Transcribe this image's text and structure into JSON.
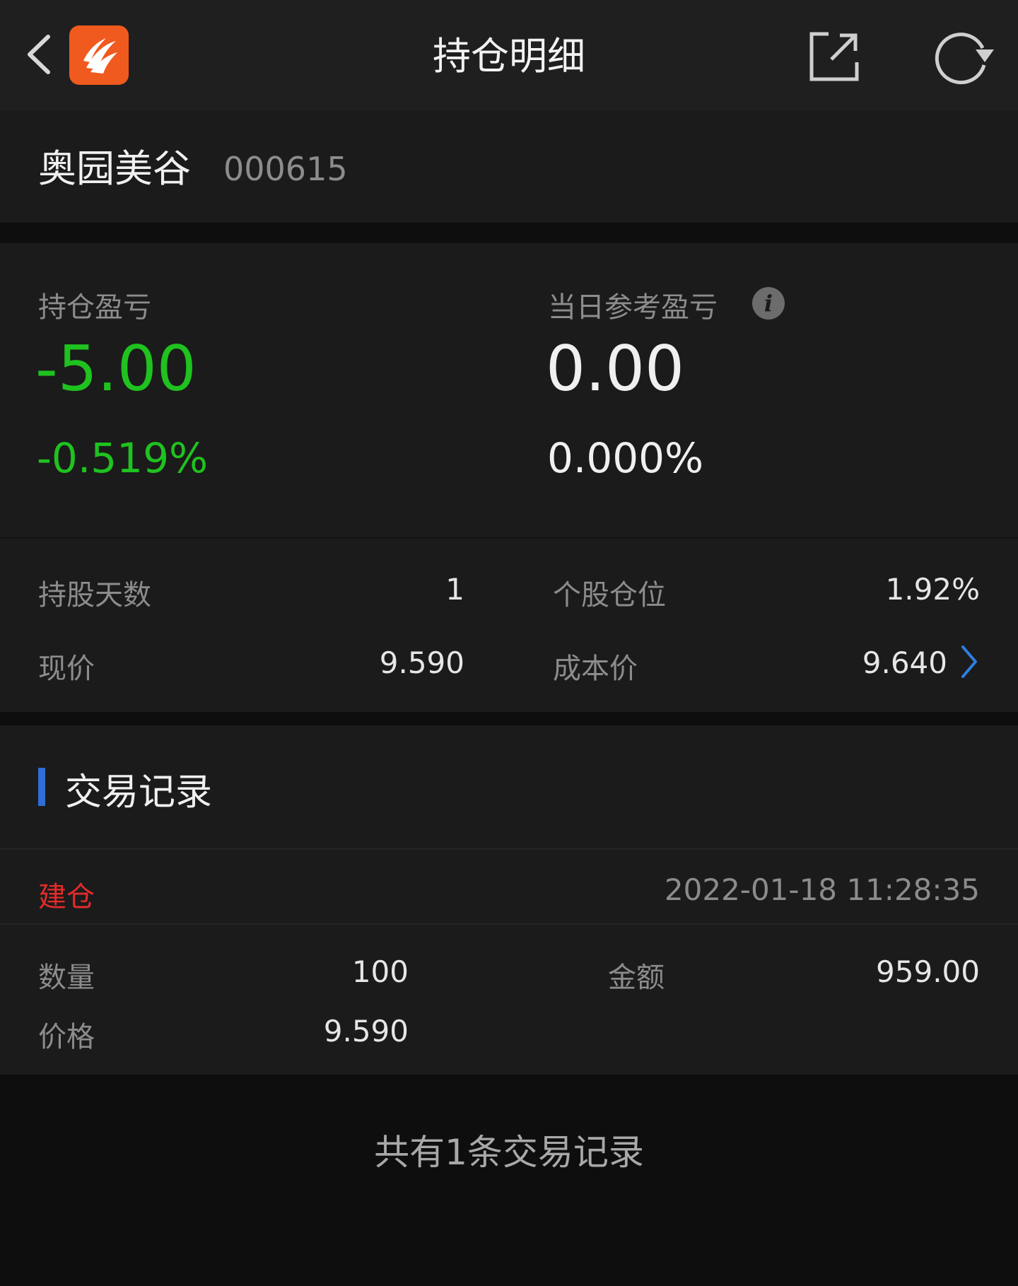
{
  "header": {
    "title": "持仓明细"
  },
  "stock": {
    "name": "奥园美谷",
    "code": "000615"
  },
  "pl": {
    "position_label": "持仓盈亏",
    "position_value": "-5.00",
    "position_pct": "-0.519%",
    "daily_label": "当日参考盈亏",
    "daily_value": "0.00",
    "daily_pct": "0.000%",
    "info_glyph": "i"
  },
  "stats": {
    "hold_days_label": "持股天数",
    "hold_days": "1",
    "position_ratio_label": "个股仓位",
    "position_ratio": "1.92%",
    "price_label": "现价",
    "price": "9.590",
    "cost_label": "成本价",
    "cost": "9.640"
  },
  "records": {
    "section_title": "交易记录",
    "items": [
      {
        "type": "建仓",
        "time": "2022-01-18 11:28:35",
        "qty_label": "数量",
        "qty": "100",
        "amount_label": "金额",
        "amount": "959.00",
        "price_label": "价格",
        "price": "9.590"
      }
    ],
    "summary": "共有1条交易记录"
  },
  "colors": {
    "profit_loss_green": "#1fc21f",
    "accent_blue": "#2f6fd6",
    "record_red": "#e22b2b",
    "logo_orange": "#f05a1e"
  },
  "icons": [
    "back-icon",
    "app-logo-icon",
    "share-icon",
    "refresh-icon",
    "info-icon",
    "chevron-right-icon"
  ]
}
